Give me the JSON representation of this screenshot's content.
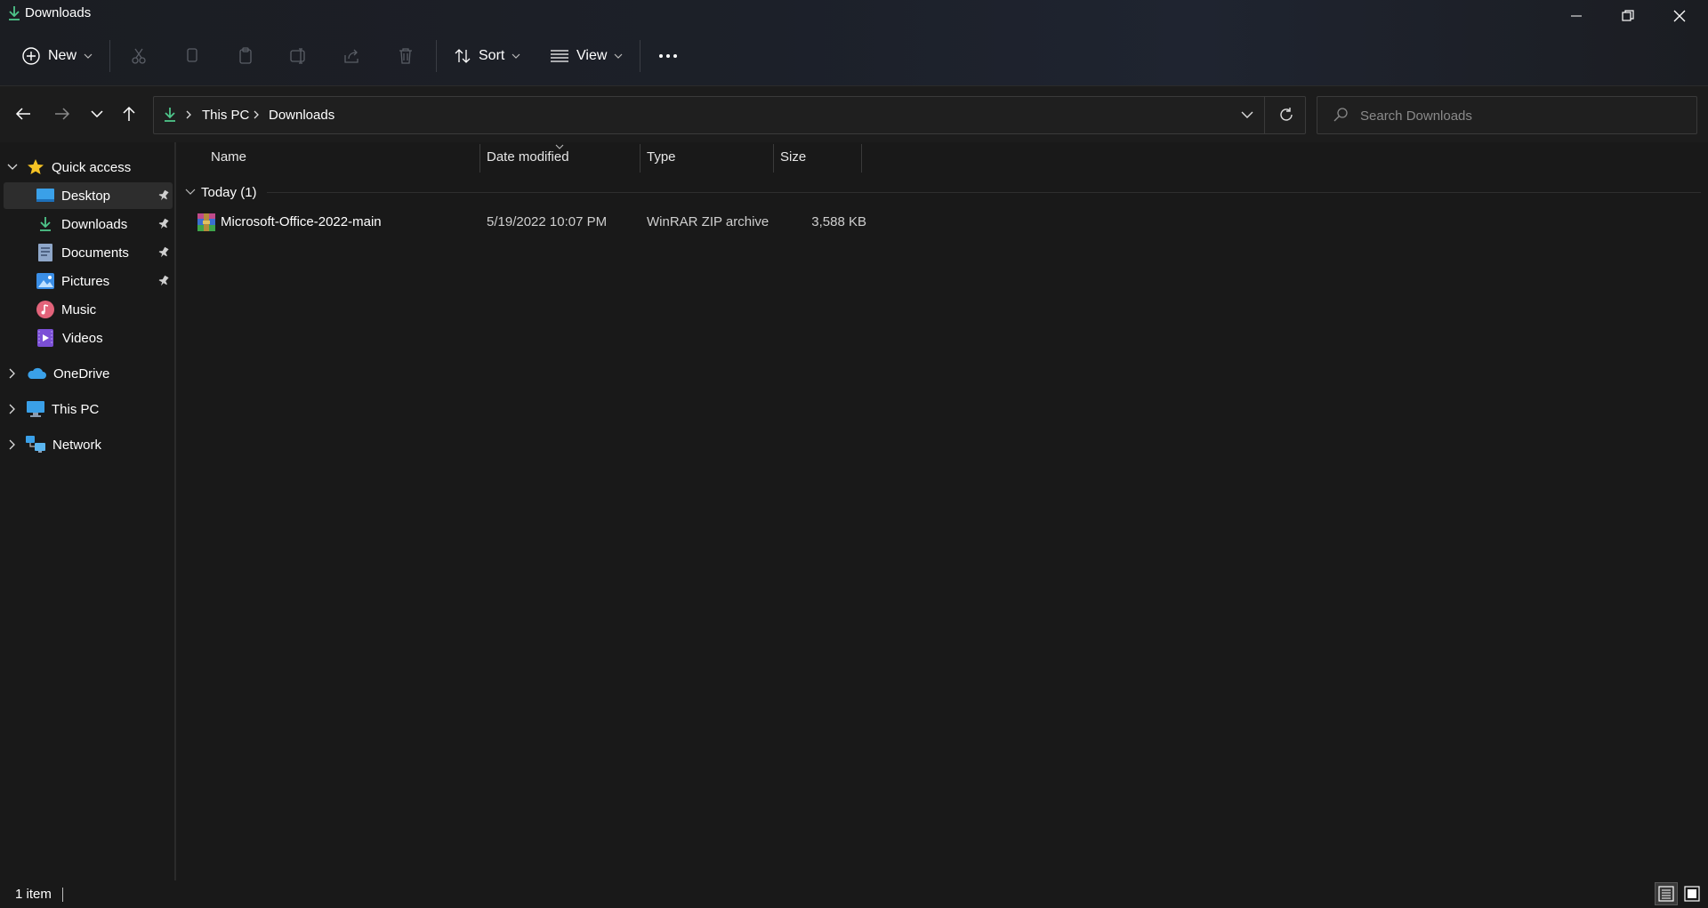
{
  "window": {
    "title": "Downloads",
    "accent": "#4ec58a"
  },
  "toolbar": {
    "new_label": "New",
    "sort_label": "Sort",
    "view_label": "View"
  },
  "address": {
    "crumbs": [
      "This PC",
      "Downloads"
    ]
  },
  "search": {
    "placeholder": "Search Downloads"
  },
  "sidebar": {
    "quick_access": "Quick access",
    "items": [
      {
        "label": "Desktop",
        "pinned": true
      },
      {
        "label": "Downloads",
        "pinned": true
      },
      {
        "label": "Documents",
        "pinned": true
      },
      {
        "label": "Pictures",
        "pinned": true
      },
      {
        "label": "Music",
        "pinned": false
      },
      {
        "label": "Videos",
        "pinned": false
      }
    ],
    "onedrive": "OneDrive",
    "this_pc": "This PC",
    "network": "Network"
  },
  "file_list": {
    "columns": [
      "Name",
      "Date modified",
      "Type",
      "Size"
    ],
    "group_label": "Today (1)",
    "rows": [
      {
        "name": "Microsoft-Office-2022-main",
        "date": "5/19/2022 10:07 PM",
        "type": "WinRAR ZIP archive",
        "size": "3,588 KB"
      }
    ]
  },
  "status": {
    "count": "1 item"
  }
}
